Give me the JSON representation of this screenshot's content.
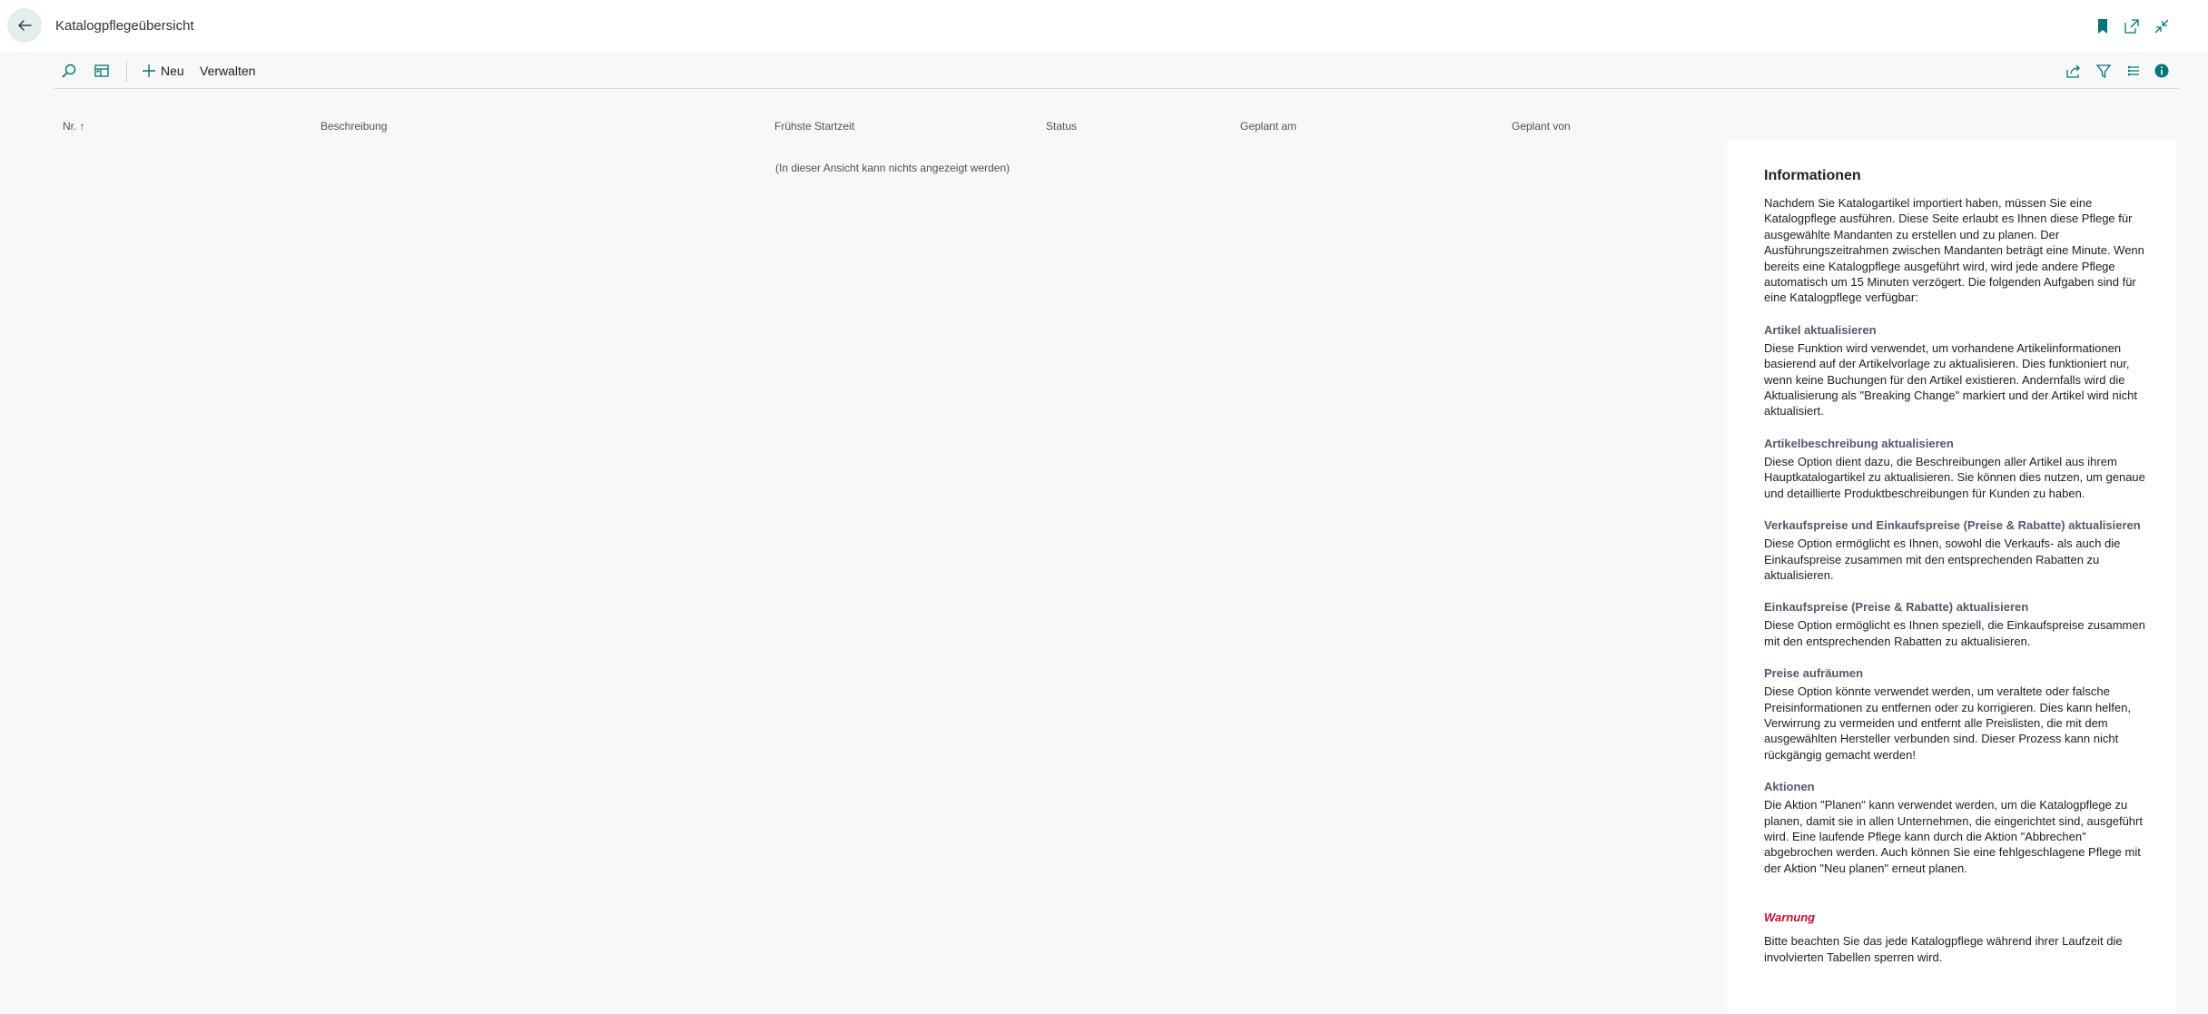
{
  "header": {
    "title": "Katalogpflegeübersicht",
    "back_icon": "arrow-left-icon",
    "right_icons": [
      "bookmark-icon",
      "open-new-window-icon",
      "collapse-icon"
    ]
  },
  "actionbar": {
    "search_icon": "search-icon",
    "layout_icon": "layout-icon",
    "new_label": "Neu",
    "manage_label": "Verwalten",
    "right_icons": [
      "share-icon",
      "filter-icon",
      "list-view-icon",
      "info-icon"
    ]
  },
  "table": {
    "columns": [
      "Nr. ↑",
      "Beschreibung",
      "Frühste Startzeit",
      "Status",
      "Geplant am",
      "Geplant von"
    ],
    "empty_message": "(In dieser Ansicht kann nichts angezeigt werden)"
  },
  "info": {
    "title": "Informationen",
    "intro": "Nachdem Sie Katalogartikel importiert haben, müssen Sie eine Katalogpflege ausführen. Diese Seite erlaubt es Ihnen diese Pflege für ausgewählte Mandanten zu erstellen und zu planen. Der Ausführungszeitrahmen zwischen Mandanten beträgt eine Minute. Wenn bereits eine Katalogpflege ausgeführt wird, wird jede andere Pflege automatisch um 15 Minuten verzögert. Die folgenden Aufgaben sind für eine Katalogpflege verfügbar:",
    "sections": [
      {
        "heading": "Artikel aktualisieren",
        "text": "Diese Funktion wird verwendet, um vorhandene Artikelinformationen basierend auf der Artikelvorlage zu aktualisieren. Dies funktioniert nur, wenn keine Buchungen für den Artikel existieren. Andernfalls wird die Aktualisierung als \"Breaking Change\" markiert und der Artikel wird nicht aktualisiert."
      },
      {
        "heading": "Artikelbeschreibung aktualisieren",
        "text": "Diese Option dient dazu, die Beschreibungen aller Artikel aus ihrem Hauptkatalogartikel zu aktualisieren. Sie können dies nutzen, um genaue und detaillierte Produktbeschreibungen für Kunden zu haben."
      },
      {
        "heading": "Verkaufspreise und Einkaufspreise (Preise & Rabatte) aktualisieren",
        "text": "Diese Option ermöglicht es Ihnen, sowohl die Verkaufs- als auch die Einkaufspreise zusammen mit den entsprechenden Rabatten zu aktualisieren."
      },
      {
        "heading": "Einkaufspreise (Preise & Rabatte) aktualisieren",
        "text": "Diese Option ermöglicht es Ihnen speziell, die Einkaufspreise zusammen mit den entsprechenden Rabatten zu aktualisieren."
      },
      {
        "heading": "Preise aufräumen",
        "text": "Diese Option könnte verwendet werden, um veraltete oder falsche Preisinformationen zu entfernen oder zu korrigieren. Dies kann helfen, Verwirrung zu vermeiden und entfernt alle Preislisten, die mit dem ausgewählten Hersteller verbunden sind. Dieser Prozess kann nicht rückgängig gemacht werden!"
      },
      {
        "heading": "Aktionen",
        "text": "Die Aktion \"Planen\" kann verwendet werden, um die Katalogpflege zu planen, damit sie in allen Unternehmen, die eingerichtet sind, ausgeführt wird. Eine laufende Pflege kann durch die Aktion \"Abbrechen\" abgebrochen werden. Auch können Sie eine fehlgeschlagene Pflege mit der Aktion \"Neu planen\" erneut planen."
      }
    ],
    "warning_heading": "Warnung",
    "warning_text": "Bitte beachten Sie das jede Katalogpflege während ihrer Laufzeit die involvierten Tabellen sperren wird."
  },
  "colors": {
    "accent": "#00757a",
    "warning": "#c8102e",
    "back_button_bg": "#e3eeee"
  }
}
